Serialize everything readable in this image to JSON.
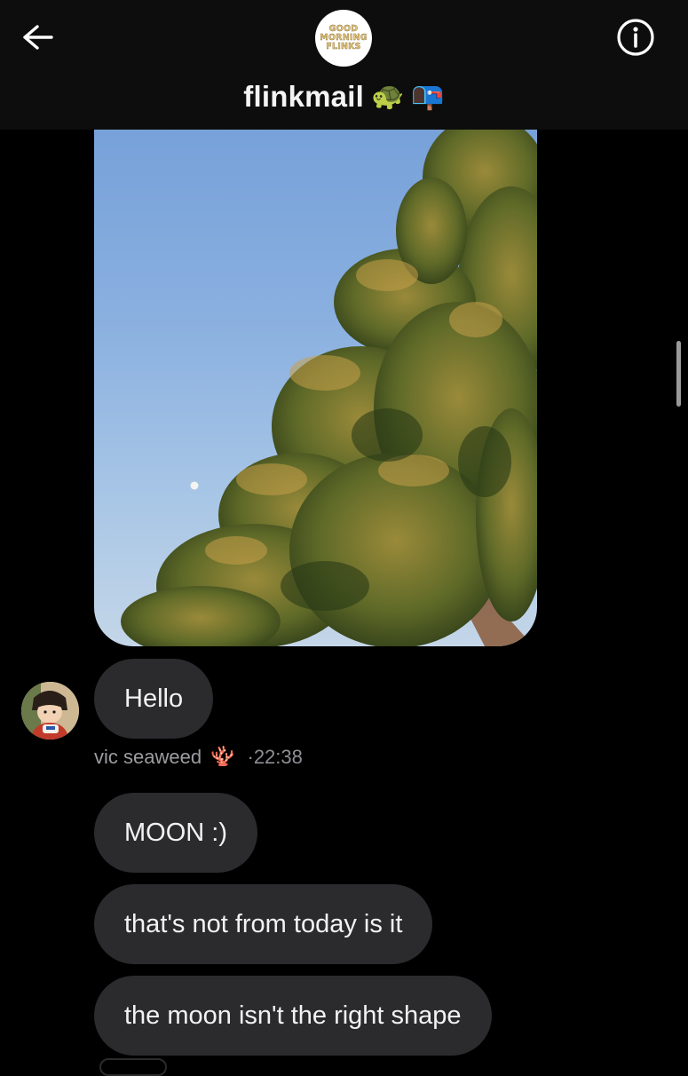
{
  "header": {
    "back_icon": "arrow-left-icon",
    "info_icon": "info-circle-icon",
    "title": "flinkmail",
    "title_emojis": [
      "🐢",
      "📭"
    ],
    "group_avatar_text": [
      "GOOD",
      "MORNING",
      "FLINKS"
    ]
  },
  "messages": [
    {
      "type": "image",
      "description_icon": "photo"
    },
    {
      "type": "text",
      "text": "Hello"
    },
    {
      "type": "text",
      "text": "MOON :)"
    },
    {
      "type": "text",
      "text": "that's not from today is it"
    },
    {
      "type": "text",
      "text": "the moon isn't the right shape"
    }
  ],
  "meta": {
    "sender_name": "vic seaweed",
    "sender_emoji": "🪸",
    "separator": "·",
    "time": "22:38"
  },
  "colors": {
    "background": "#000000",
    "header": "#0d0d0d",
    "bubble": "#2b2b2e",
    "meta_text": "#8e8e93"
  }
}
